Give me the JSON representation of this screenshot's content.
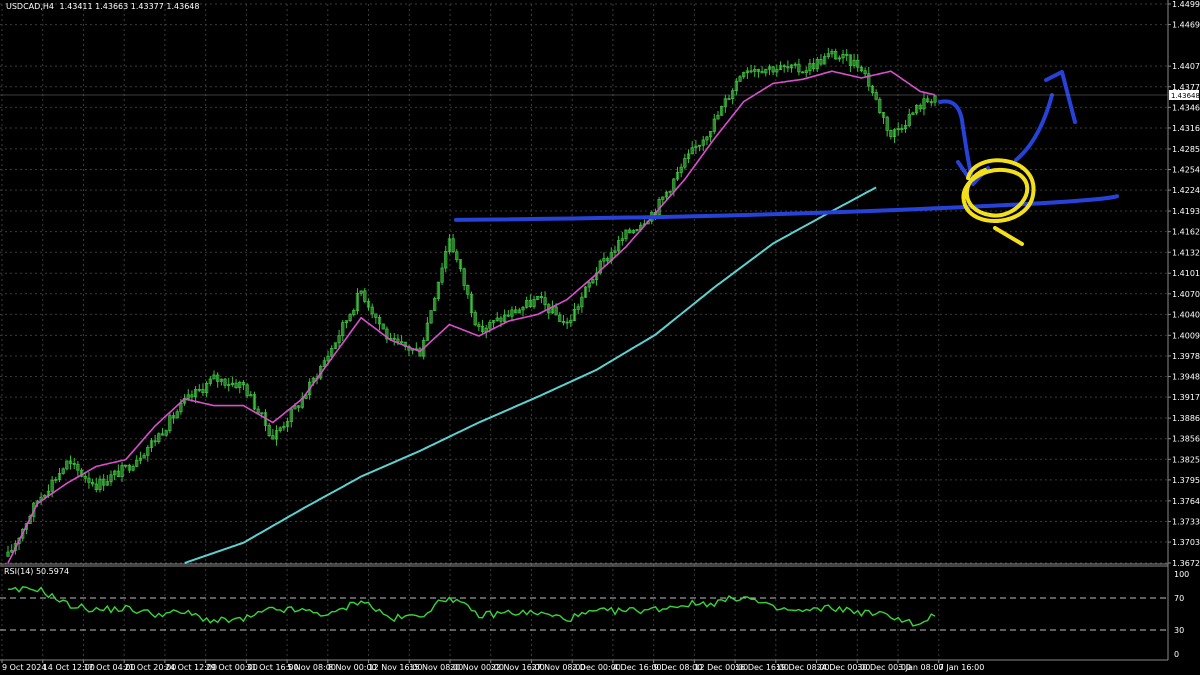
{
  "header": {
    "symbol_info": "USDCAD,H4",
    "ohlc": "1.43411 1.43663 1.43377 1.43648"
  },
  "rsi_panel": {
    "label": "RSI(14) 50.5974",
    "levels_text": [
      "100",
      "70",
      "30",
      "0"
    ]
  },
  "colors": {
    "background": "#000000",
    "grid": "#3a3a3a",
    "candle": "#3fbf3f",
    "ma_fast": "#d94fcf",
    "ma_slow": "#5fd0d0",
    "rsi": "#37d637",
    "current_price_badge": "#ffffff",
    "annotation_blue": "#2742d9",
    "annotation_yellow": "#f3e01a"
  },
  "chart_data": [
    {
      "type": "line",
      "chart": "price",
      "y_ticks": [
        "1.44995",
        "1.44690",
        "1.44075",
        "1.43770",
        "1.43465",
        "1.43160",
        "1.42850",
        "1.42545",
        "1.42240",
        "1.41930",
        "1.41625",
        "1.41320",
        "1.41010",
        "1.40705",
        "1.40400",
        "1.40090",
        "1.39785",
        "1.39480",
        "1.39175",
        "1.38865",
        "1.38560",
        "1.38255",
        "1.37950",
        "1.37640",
        "1.37335",
        "1.37030",
        "1.36720"
      ],
      "current_price": "1.43648",
      "ylim": [
        1.3672,
        1.44995
      ],
      "x_ticks": [
        "9 Oct 2024",
        "14 Oct 12:00",
        "17 Oct 04:00",
        "21 Oct 20:00",
        "24 Oct 12:00",
        "29 Oct 00:00",
        "31 Oct 16:00",
        "5 Nov 08:00",
        "8 Nov 00:00",
        "12 Nov 16:00",
        "15 Nov 08:00",
        "20 Nov 00:00",
        "22 Nov 16:00",
        "27 Nov 08:00",
        "2 Dec 00:00",
        "4 Dec 16:00",
        "9 Dec 08:00",
        "12 Dec 00:00",
        "16 Dec 16:00",
        "19 Dec 08:00",
        "24 Dec 00:00",
        "30 Dec 00:00",
        "3 Jan 08:00",
        "7 Jan 16:00"
      ],
      "x_index_range": [
        0,
        252
      ],
      "close": {
        "x": [
          0,
          8,
          16,
          24,
          32,
          40,
          48,
          56,
          64,
          72,
          80,
          88,
          96,
          104,
          112,
          120,
          128,
          136,
          144,
          152,
          160,
          168,
          176,
          184,
          192,
          200,
          208,
          216,
          224,
          232,
          240,
          248,
          252
        ],
        "y": [
          1.3682,
          1.3765,
          1.382,
          1.3788,
          1.3812,
          1.3855,
          1.391,
          1.3945,
          1.3935,
          1.3858,
          1.3915,
          1.399,
          1.4075,
          1.3998,
          1.3985,
          1.4155,
          1.4015,
          1.404,
          1.4062,
          1.4025,
          1.4105,
          1.4158,
          1.4195,
          1.4265,
          1.4325,
          1.4405,
          1.4405,
          1.4402,
          1.4425,
          1.4408,
          1.4305,
          1.435,
          1.4364
        ]
      },
      "series": [
        {
          "name": "",
          "role": "fast moving average",
          "x": [
            0,
            8,
            16,
            24,
            32,
            40,
            48,
            56,
            64,
            72,
            80,
            88,
            96,
            104,
            112,
            120,
            128,
            136,
            144,
            152,
            160,
            168,
            176,
            184,
            192,
            200,
            208,
            216,
            224,
            232,
            240,
            248,
            252
          ],
          "y": [
            1.3672,
            1.376,
            1.379,
            1.3815,
            1.3825,
            1.3875,
            1.3915,
            1.3905,
            1.3905,
            1.388,
            1.3915,
            1.3975,
            1.4035,
            1.4002,
            1.3985,
            1.4025,
            1.4008,
            1.403,
            1.404,
            1.4062,
            1.41,
            1.414,
            1.419,
            1.424,
            1.43,
            1.4355,
            1.4382,
            1.4388,
            1.44,
            1.439,
            1.44,
            1.437,
            1.4365
          ]
        },
        {
          "name": "",
          "role": "slow moving average",
          "x": [
            48,
            64,
            80,
            96,
            112,
            128,
            144,
            160,
            176,
            192,
            208,
            224,
            236
          ],
          "y": [
            1.3672,
            1.3702,
            1.3752,
            1.38,
            1.3838,
            1.388,
            1.3918,
            1.3958,
            1.401,
            1.408,
            1.4145,
            1.4193,
            1.4228
          ]
        }
      ],
      "annotations": [
        {
          "type": "horizontal-line",
          "color": "annotation_blue",
          "level_y": [
            1.418,
            1.4215
          ]
        },
        {
          "type": "arrow-down",
          "color": "annotation_blue"
        },
        {
          "type": "arrow-up",
          "color": "annotation_blue"
        },
        {
          "type": "ellipse",
          "color": "annotation_yellow",
          "center_price": 1.422
        }
      ]
    },
    {
      "type": "line",
      "chart": "rsi",
      "ylim": [
        0,
        100
      ],
      "levels": [
        70,
        30
      ],
      "x": [
        0,
        8,
        16,
        24,
        32,
        40,
        48,
        56,
        64,
        72,
        80,
        88,
        96,
        104,
        112,
        120,
        128,
        136,
        144,
        152,
        160,
        168,
        176,
        184,
        192,
        200,
        208,
        216,
        224,
        232,
        240,
        248,
        252
      ],
      "y": [
        78,
        82,
        62,
        55,
        57,
        50,
        52,
        41,
        43,
        56,
        54,
        49,
        68,
        44,
        48,
        72,
        48,
        52,
        51,
        44,
        53,
        54,
        56,
        62,
        64,
        72,
        57,
        53,
        58,
        52,
        48,
        35,
        50.6
      ],
      "current_value": 50.5974
    }
  ]
}
